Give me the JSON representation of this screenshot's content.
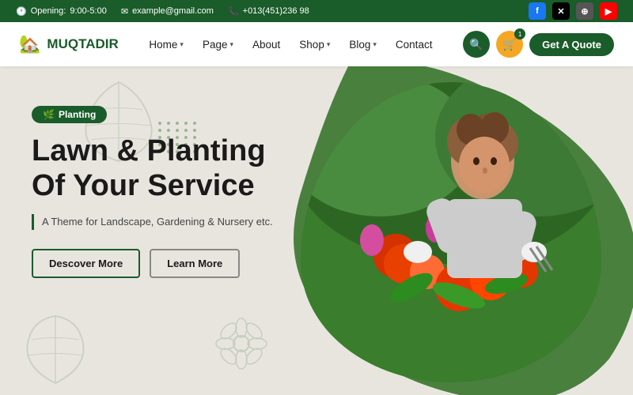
{
  "topbar": {
    "opening_label": "Opening:",
    "opening_hours": "9:00-5:00",
    "email": "example@gmail.com",
    "phone": "+013(451)236 98",
    "socials": [
      {
        "name": "Facebook",
        "symbol": "f",
        "type": "fb"
      },
      {
        "name": "X / Twitter",
        "symbol": "✕",
        "type": "x"
      },
      {
        "name": "Globe",
        "symbol": "⊕",
        "type": "globe"
      },
      {
        "name": "YouTube",
        "symbol": "▶",
        "type": "yt"
      }
    ]
  },
  "navbar": {
    "logo_text": "MUQTADIR",
    "links": [
      {
        "label": "Home",
        "has_arrow": true
      },
      {
        "label": "Page",
        "has_arrow": true
      },
      {
        "label": "About",
        "has_arrow": false
      },
      {
        "label": "Shop",
        "has_arrow": true
      },
      {
        "label": "Blog",
        "has_arrow": true
      },
      {
        "label": "Contact",
        "has_arrow": false
      }
    ],
    "quote_btn": "Get A Quote"
  },
  "hero": {
    "badge_icon": "🌿",
    "badge_text": "Planting",
    "title_line1": "Lawn & Planting",
    "title_line2": "Of Your Service",
    "subtitle": "A Theme for Landscape, Gardening & Nursery etc.",
    "btn1": "Descover More",
    "btn2": "Learn More"
  }
}
